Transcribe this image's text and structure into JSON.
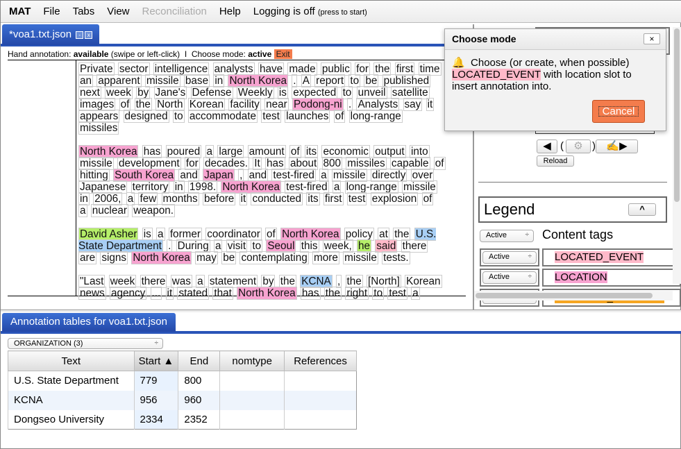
{
  "menubar": {
    "app": "MAT",
    "items": [
      "File",
      "Tabs",
      "View",
      "Reconciliation",
      "Help"
    ],
    "logging": "Logging is off",
    "logging_hint": "(press to start)"
  },
  "doc_tab": {
    "label": "*voa1.txt.json",
    "minimize": "-",
    "close": "x"
  },
  "status": {
    "hand_label": "Hand annotation:",
    "hand_value": "available",
    "hand_hint": "(swipe or left-click)",
    "sep": "I",
    "mode_label": "Choose mode:",
    "mode_value": "active",
    "exit": "Exit"
  },
  "document": {
    "paragraphs": [
      [
        {
          "t": "Private sector intelligence analysts have made public for the first time an apparent missile base in"
        },
        {
          "t": "North Korea",
          "c": "loc"
        },
        {
          "t": ". A report to be published next week by Jane's Defense Weekly is expected to unveil satellite images of the North Korean facility near"
        },
        {
          "t": "Podong-ni",
          "c": "loc"
        },
        {
          "t": ". Analysts say it appears designed to accommodate test launches of long-range missiles"
        }
      ],
      [
        {
          "t": "North Korea",
          "c": "loc"
        },
        {
          "t": "has poured a large amount of its economic output into missile development for decades. It has about 800 missiles capable of hitting"
        },
        {
          "t": "South Korea",
          "c": "loc"
        },
        {
          "t": "and"
        },
        {
          "t": "Japan",
          "c": "loc"
        },
        {
          "t": ", and test-fired a missile directly over Japanese territory in 1998."
        },
        {
          "t": "North Korea",
          "c": "loc"
        },
        {
          "t": "test-fired a long-range missile in 2006, a few months before it conducted its first test explosion of a nuclear weapon."
        }
      ],
      [
        {
          "t": "David Asher",
          "c": "per"
        },
        {
          "t": "is a former coordinator of"
        },
        {
          "t": "North Korea",
          "c": "loc"
        },
        {
          "t": "policy at the"
        },
        {
          "t": "U.S. State Department",
          "c": "org"
        },
        {
          "t": ". During a visit to"
        },
        {
          "t": "Seoul",
          "c": "loc"
        },
        {
          "t": "this week,"
        },
        {
          "t": "he",
          "c": "per"
        },
        {
          "t": "said",
          "c": "evt"
        },
        {
          "t": "there are signs"
        },
        {
          "t": "North Korea",
          "c": "loc"
        },
        {
          "t": "may be contemplating more missile tests."
        }
      ],
      [
        {
          "t": "\"Last week there was a statement by the"
        },
        {
          "t": "KCNA",
          "c": "org"
        },
        {
          "t": ", the [North] Korean news agency ... it stated that"
        },
        {
          "t": "North Korea",
          "c": "loc"
        },
        {
          "t": "has the right to test a"
        }
      ]
    ]
  },
  "dialog": {
    "title": "Choose mode",
    "close": "×",
    "icon": "bell-icon",
    "msg_pre": "Choose (or create, when possible)",
    "tag": "LOCATED_EVENT",
    "msg_post": "with location slot to insert annotation into.",
    "cancel": "Cancel"
  },
  "controls": {
    "reload": "Reload",
    "gear": "⚙",
    "paren_open": "(",
    "paren_close": ")"
  },
  "legend": {
    "title": "Legend",
    "collapse": "^",
    "group_select": "Active",
    "group_label": "Content tags",
    "rows": [
      {
        "select": "Active",
        "tag": "LOCATED_EVENT",
        "color": "#ffb9c9"
      },
      {
        "select": "Active",
        "tag": "LOCATION",
        "color": "#f7a3d0"
      },
      {
        "select": "Active",
        "tag": "LOCATION_RELATION",
        "color": "#f5a623"
      }
    ]
  },
  "tables_tab": {
    "label": "Annotation tables for voa1.txt.json"
  },
  "table": {
    "type_select": "ORGANIZATION (3)",
    "columns": [
      "Text",
      "Start ▲",
      "End",
      "nomtype",
      "References"
    ],
    "rows": [
      [
        "U.S. State Department",
        "779",
        "800",
        "",
        ""
      ],
      [
        "KCNA",
        "956",
        "960",
        "",
        ""
      ],
      [
        "Dongseo University",
        "2334",
        "2352",
        "",
        ""
      ]
    ]
  }
}
